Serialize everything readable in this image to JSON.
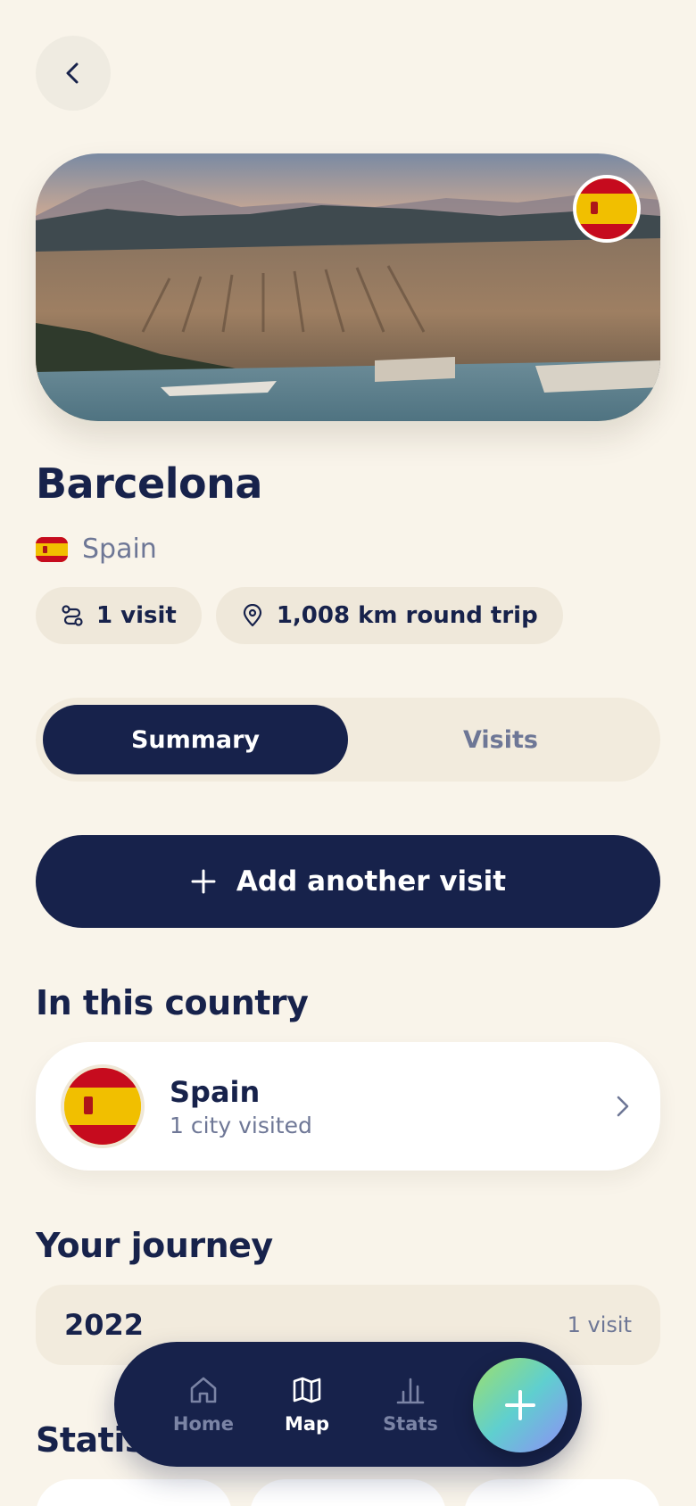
{
  "city": {
    "name": "Barcelona",
    "country": "Spain"
  },
  "stats_chips": [
    {
      "icon": "route-icon",
      "label": "1 visit"
    },
    {
      "icon": "map-pin-icon",
      "label": "1,008 km round trip"
    }
  ],
  "tabs": [
    {
      "label": "Summary",
      "active": true
    },
    {
      "label": "Visits",
      "active": false
    }
  ],
  "add_visit_label": "Add another visit",
  "in_country": {
    "title": "In this country",
    "card": {
      "title": "Spain",
      "subtitle": "1 city visited"
    }
  },
  "journey": {
    "title": "Your journey",
    "rows": [
      {
        "year": "2022",
        "count": "1 visit"
      }
    ]
  },
  "statistics_title": "Statistics",
  "nav": {
    "items": [
      {
        "label": "Home",
        "icon": "home-icon",
        "active": false
      },
      {
        "label": "Map",
        "icon": "map-icon",
        "active": true
      },
      {
        "label": "Stats",
        "icon": "bar-chart-icon",
        "active": false
      }
    ],
    "fab_icon": "plus-icon"
  },
  "colors": {
    "background": "#f9f4ea",
    "navy": "#17224b",
    "muted": "#6e7796",
    "chip": "#efe8da",
    "flag_red": "#c60b1e",
    "flag_yellow": "#f1bf00"
  }
}
